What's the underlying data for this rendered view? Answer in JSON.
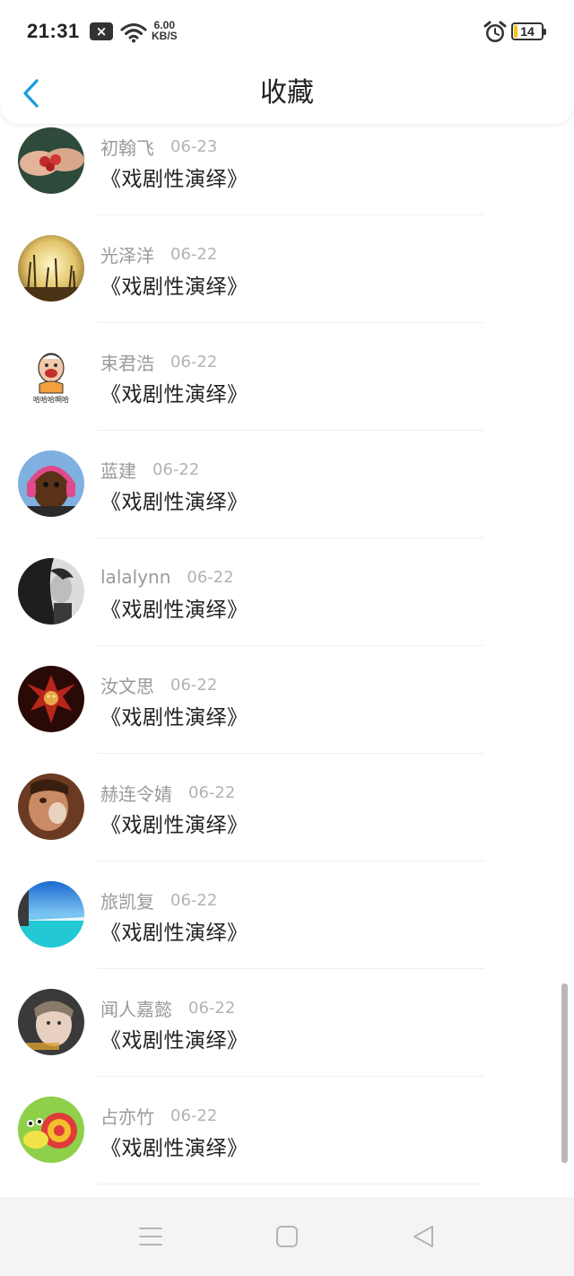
{
  "status_bar": {
    "time": "21:31",
    "notification_icon": "close-notification-icon",
    "speed_value": "6.00",
    "speed_unit": "KB/S",
    "battery_level": "14"
  },
  "header": {
    "title": "收藏",
    "back_icon": "chevron-left-icon",
    "accent_color": "#1a9bdb"
  },
  "favorites": [
    {
      "name": "初翰飞",
      "date": "06-23",
      "title": "《戏剧性演绎》"
    },
    {
      "name": "光泽洋",
      "date": "06-22",
      "title": "《戏剧性演绎》"
    },
    {
      "name": "束君浩",
      "date": "06-22",
      "title": "《戏剧性演绎》"
    },
    {
      "name": "蓝建",
      "date": "06-22",
      "title": "《戏剧性演绎》"
    },
    {
      "name": "lalalynn",
      "date": "06-22",
      "title": "《戏剧性演绎》"
    },
    {
      "name": "汝文思",
      "date": "06-22",
      "title": "《戏剧性演绎》"
    },
    {
      "name": "赫连令婧",
      "date": "06-22",
      "title": "《戏剧性演绎》"
    },
    {
      "name": "旅凯复",
      "date": "06-22",
      "title": "《戏剧性演绎》"
    },
    {
      "name": "闻人嘉懿",
      "date": "06-22",
      "title": "《戏剧性演绎》"
    },
    {
      "name": "占亦竹",
      "date": "06-22",
      "title": "《戏剧性演绎》"
    }
  ],
  "avatar_meme_caption": "哈哈哈啊哈",
  "system_nav": {
    "menu_icon": "menu-lines-icon",
    "home_icon": "home-square-icon",
    "back_icon": "back-triangle-icon"
  }
}
